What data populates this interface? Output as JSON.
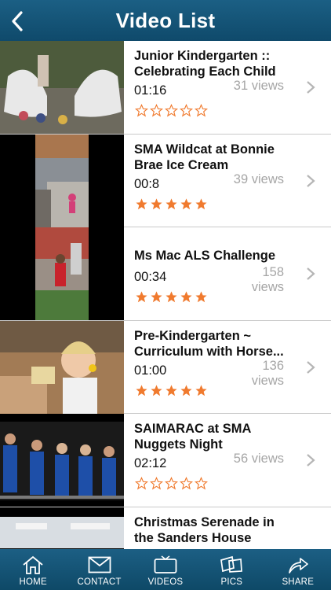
{
  "header": {
    "title": "Video List"
  },
  "videos": [
    {
      "title_line1": "Junior Kindergarten ::",
      "title_line2": "Celebrating Each Child",
      "duration": "01:16",
      "views": "31 views",
      "rating": 0
    },
    {
      "title_line1": "SMA Wildcat at Bonnie",
      "title_line2": "Brae Ice Cream",
      "duration": "00:8",
      "views": "39 views",
      "rating": 5
    },
    {
      "title_line1": "Ms Mac ALS Challenge",
      "title_line2": "",
      "duration": "00:34",
      "views": "158 views",
      "rating": 5
    },
    {
      "title_line1": "Pre-Kindergarten ~",
      "title_line2": "Curriculum with Horse...",
      "duration": "01:00",
      "views": "136 views",
      "rating": 5
    },
    {
      "title_line1": "SAIMARAC at SMA",
      "title_line2": "Nuggets Night",
      "duration": "02:12",
      "views": "56 views",
      "rating": 0
    },
    {
      "title_line1": "Christmas Serenade in",
      "title_line2": "the Sanders House",
      "duration": "",
      "views": "",
      "rating": 0
    }
  ],
  "tabbar": {
    "home": "HOME",
    "contact": "CONTACT",
    "videos": "VIDEOS",
    "pics": "PICS",
    "share": "SHARE"
  },
  "colors": {
    "header": "#145678",
    "star": "#f07a2e",
    "views": "#a6a6a6"
  }
}
